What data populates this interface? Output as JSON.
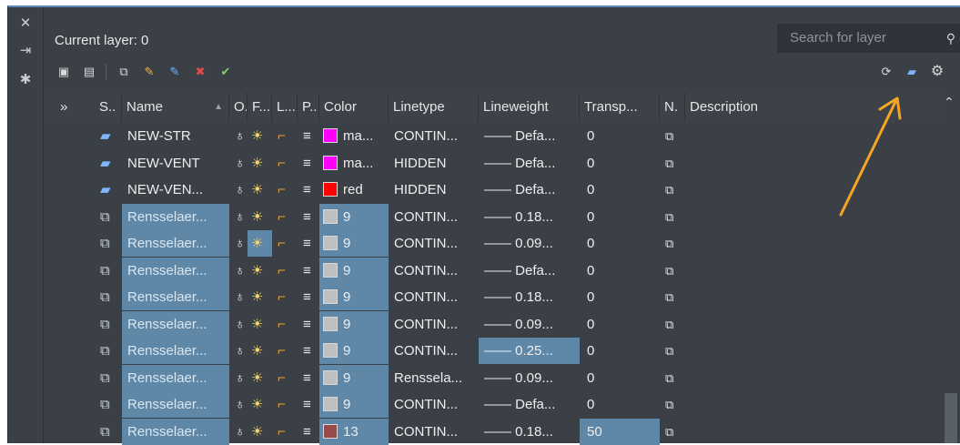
{
  "sidebar": {
    "close_icon": "✕",
    "pin_icon": "⇥",
    "settings_icon": "✱"
  },
  "header": {
    "current_layer": "Current layer: 0",
    "search_placeholder": "Search for layer"
  },
  "toolbar": {
    "left_icons": [
      "new-property-filter-icon",
      "new-group-filter-icon",
      "layer-states-icon",
      "new-layer-icon",
      "new-layer-vp-frozen-icon",
      "delete-layer-icon",
      "set-current-icon"
    ],
    "right_icons": [
      "refresh-icon",
      "layer-settings-icon",
      "gear-icon"
    ]
  },
  "columns": [
    "S..",
    "Name",
    "O.",
    "F...",
    "L...",
    "P..",
    "Color",
    "Linetype",
    "Lineweight",
    "Transp...",
    "N.",
    "Description"
  ],
  "expand_label": "»",
  "rows": [
    {
      "name": "NEW-STR",
      "color_name": "ma...",
      "color_hex": "#ff00ff",
      "linetype": "CONTIN...",
      "lineweight": "Defa...",
      "transp": "0",
      "sel": false
    },
    {
      "name": "NEW-VENT",
      "color_name": "ma...",
      "color_hex": "#ff00ff",
      "linetype": "HIDDEN",
      "lineweight": "Defa...",
      "transp": "0",
      "sel": false
    },
    {
      "name": "NEW-VEN...",
      "color_name": "red",
      "color_hex": "#ff0000",
      "linetype": "HIDDEN",
      "lineweight": "Defa...",
      "transp": "0",
      "sel": false
    },
    {
      "name": "Rensselaer...",
      "color_name": "9",
      "color_hex": "#c0c0c0",
      "linetype": "CONTIN...",
      "lineweight": "0.18...",
      "transp": "0",
      "sel": true
    },
    {
      "name": "Rensselaer...",
      "color_name": "9",
      "color_hex": "#c0c0c0",
      "linetype": "CONTIN...",
      "lineweight": "0.09...",
      "transp": "0",
      "sel": true
    },
    {
      "name": "Rensselaer...",
      "color_name": "9",
      "color_hex": "#c0c0c0",
      "linetype": "CONTIN...",
      "lineweight": "Defa...",
      "transp": "0",
      "sel": true
    },
    {
      "name": "Rensselaer...",
      "color_name": "9",
      "color_hex": "#c0c0c0",
      "linetype": "CONTIN...",
      "lineweight": "0.18...",
      "transp": "0",
      "sel": true
    },
    {
      "name": "Rensselaer...",
      "color_name": "9",
      "color_hex": "#c0c0c0",
      "linetype": "CONTIN...",
      "lineweight": "0.09...",
      "transp": "0",
      "sel": true
    },
    {
      "name": "Rensselaer...",
      "color_name": "9",
      "color_hex": "#c0c0c0",
      "linetype": "CONTIN...",
      "lineweight": "0.25...",
      "transp": "0",
      "sel": true
    },
    {
      "name": "Rensselaer...",
      "color_name": "9",
      "color_hex": "#c0c0c0",
      "linetype": "Renssela...",
      "lineweight": "0.09...",
      "transp": "0",
      "sel": true
    },
    {
      "name": "Rensselaer...",
      "color_name": "9",
      "color_hex": "#c0c0c0",
      "linetype": "CONTIN...",
      "lineweight": "Defa...",
      "transp": "0",
      "sel": true
    },
    {
      "name": "Rensselaer...",
      "color_name": "13",
      "color_hex": "#9a4a4a",
      "linetype": "CONTIN...",
      "lineweight": "0.18...",
      "transp": "50",
      "sel": true
    }
  ],
  "accent_colors": {
    "selection": "#5f88a8",
    "annotation_arrow": "#f5a623"
  }
}
